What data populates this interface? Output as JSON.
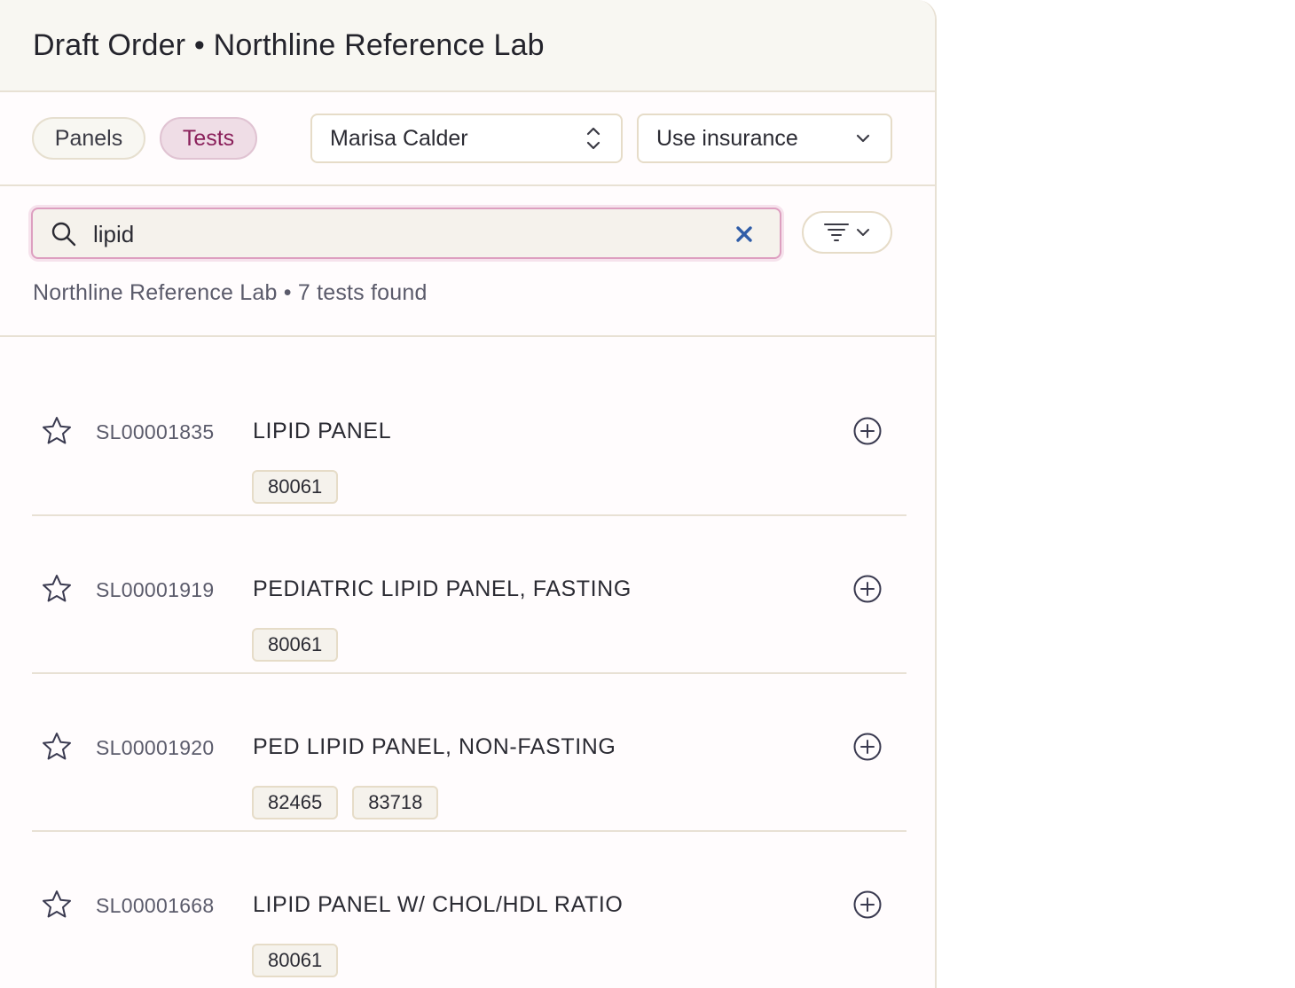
{
  "header": {
    "title": "Draft Order • Northline Reference Lab"
  },
  "toggles": {
    "panels_label": "Panels",
    "tests_label": "Tests",
    "active": "Tests"
  },
  "patient_select": {
    "value": "Marisa Calder",
    "icon": "up-down-chevron-icon"
  },
  "billing_select": {
    "value": "Use insurance",
    "icon": "chevron-down-icon"
  },
  "search": {
    "value": "lipid",
    "clear_icon": "close-icon",
    "search_icon": "search-icon"
  },
  "filter_button": {
    "icon": "filter-icon"
  },
  "summary": "Northline Reference Lab • 7 tests found",
  "results": [
    {
      "code": "SL00001835",
      "name": "LIPID PANEL",
      "cpt": [
        "80061"
      ]
    },
    {
      "code": "SL00001919",
      "name": "PEDIATRIC LIPID PANEL, FASTING",
      "cpt": [
        "80061"
      ]
    },
    {
      "code": "SL00001920",
      "name": "PED LIPID PANEL, NON-FASTING",
      "cpt": [
        "82465",
        "83718"
      ]
    },
    {
      "code": "SL00001668",
      "name": "LIPID PANEL W/ CHOL/HDL RATIO",
      "cpt": [
        "80061"
      ]
    }
  ],
  "colors": {
    "accent": "#8a1f5a",
    "accent_bg": "#efdde6",
    "clear_icon": "#2f5da8",
    "border": "#e8e1d4"
  }
}
